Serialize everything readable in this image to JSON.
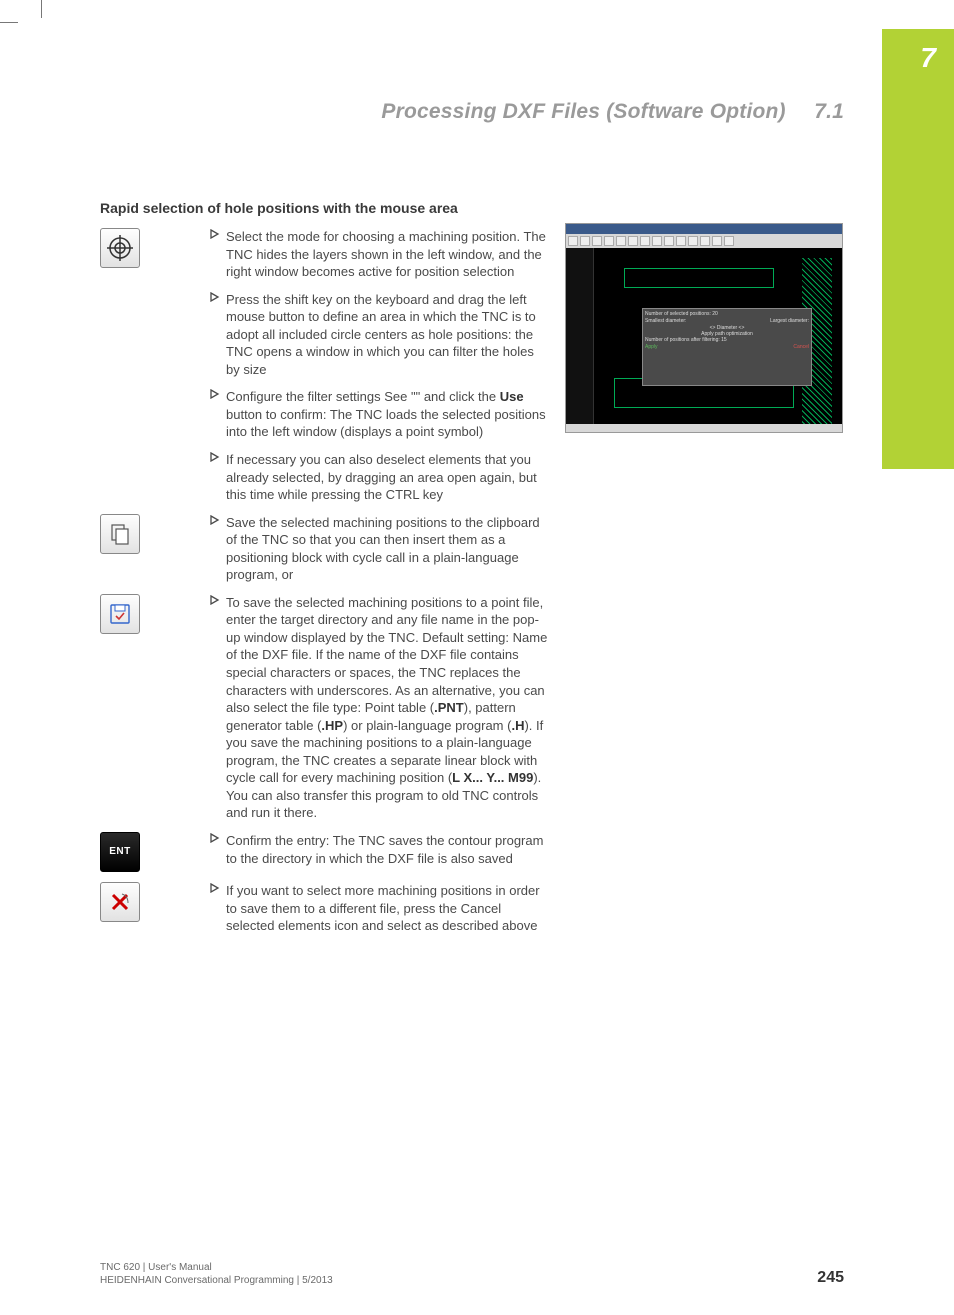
{
  "tab": {
    "number": "7"
  },
  "header": {
    "title": "Processing DXF Files (Software Option)",
    "section": "7.1"
  },
  "section": {
    "heading": "Rapid selection of hole positions with the mouse area"
  },
  "steps": [
    {
      "icon": "crosshair",
      "text": "Select the mode for choosing a machining position. The TNC hides the layers shown in the left window, and the right window becomes active for position selection"
    },
    {
      "icon": "",
      "text": "Press the shift key on the keyboard and drag the left mouse button to define an area in which the TNC is to adopt all included circle centers as hole positions: the TNC opens a window in which you can filter the holes by size"
    },
    {
      "icon": "",
      "html": "Configure the filter settings See \"\" and click the <b>Use</b> button to confirm: The TNC loads the selected positions into the left window (displays a point symbol)"
    },
    {
      "icon": "",
      "text": "If necessary you can also deselect elements that you already selected, by dragging an area open again, but this time while pressing the CTRL key"
    },
    {
      "icon": "clipboard",
      "text": "Save the selected machining positions to the clipboard of the TNC so that you can then insert them as a positioning block with cycle call in a plain-language program, or"
    },
    {
      "icon": "save-file",
      "html": "To save the selected machining positions to a point file, enter the target directory and any file name in the pop-up window displayed by the TNC. Default setting: Name of the DXF file. If the name of the DXF file contains special characters or spaces, the TNC replaces the characters with underscores. As an alternative, you can also select the file type: Point table (<b>.PNT</b>), pattern generator table (<b>.HP</b>) or plain-language program (<b>.H</b>). If you save the machining positions to a plain-language program, the TNC creates a separate linear block with cycle call for every machining position (<b>L X... Y... M99</b>). You can also transfer this program to old TNC controls and run it there."
    },
    {
      "icon": "ent",
      "text": "Confirm the entry: The TNC saves the contour program to the directory in which the DXF file is also saved"
    },
    {
      "icon": "cancel-x",
      "text": "If you want to select more machining positions in order to save them to a different file, press the Cancel selected elements icon and select as described above"
    }
  ],
  "icons": {
    "ent_label": "ENT"
  },
  "dialog": {
    "line1": "Number of selected positions: 20",
    "smallest": "Smallest diameter:",
    "largest": "Largest diameter:",
    "diameter": "<> Diameter <>",
    "optim": "Apply path optimization",
    "line2": "Number of positions after filtering: 15",
    "apply": "Apply",
    "cancel": "Cancel"
  },
  "footer": {
    "line1": "TNC 620 | User's Manual",
    "line2": "HEIDENHAIN Conversational Programming | 5/2013",
    "page": "245"
  }
}
